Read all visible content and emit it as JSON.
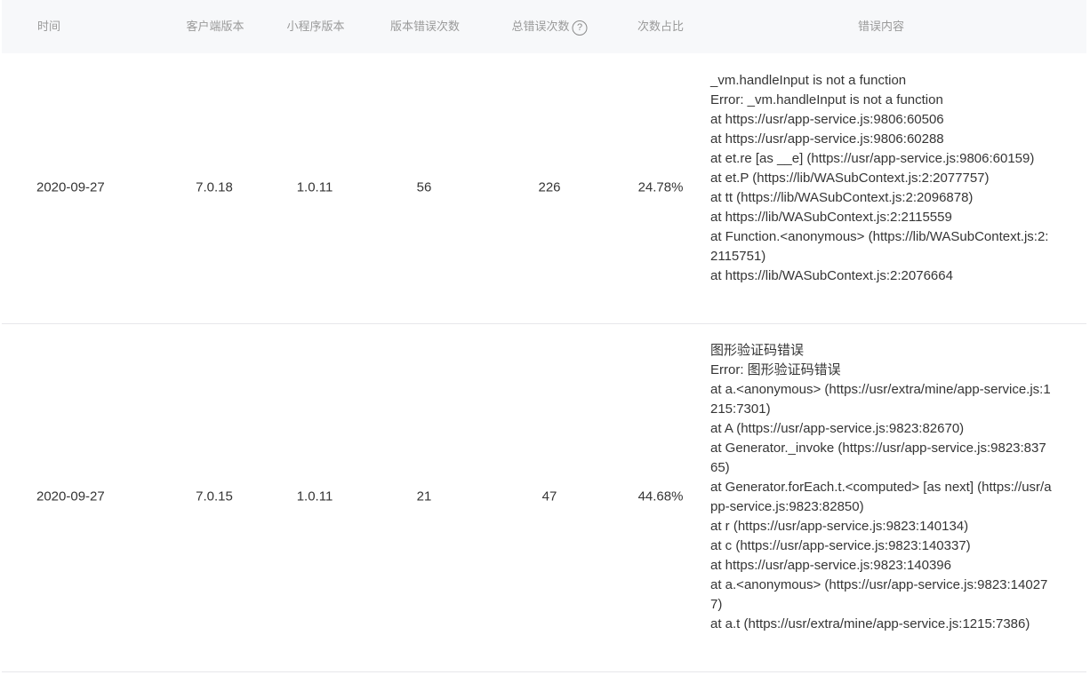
{
  "headers": {
    "time": "时间",
    "client_version": "客户端版本",
    "miniapp_version": "小程序版本",
    "version_error_count": "版本错误次数",
    "total_error_count": "总错误次数",
    "help_icon": "?",
    "ratio": "次数占比",
    "error_content": "错误内容"
  },
  "rows": [
    {
      "time": "2020-09-27",
      "client_version": "7.0.18",
      "miniapp_version": "1.0.11",
      "version_error_count": "56",
      "total_error_count": "226",
      "ratio": "24.78%",
      "error_lines": [
        "_vm.handleInput is not a function",
        "Error: _vm.handleInput is not a function",
        "at https://usr/app-service.js:9806:60506",
        "at https://usr/app-service.js:9806:60288",
        "at et.re [as __e] (https://usr/app-service.js:9806:60159)",
        "at et.P (https://lib/WASubContext.js:2:2077757)",
        "at tt (https://lib/WASubContext.js:2:2096878)",
        "at https://lib/WASubContext.js:2:2115559",
        "at Function.<anonymous> (https://lib/WASubContext.js:2:2115751)",
        "at https://lib/WASubContext.js:2:2076664"
      ]
    },
    {
      "time": "2020-09-27",
      "client_version": "7.0.15",
      "miniapp_version": "1.0.11",
      "version_error_count": "21",
      "total_error_count": "47",
      "ratio": "44.68%",
      "error_lines": [
        "图形验证码错误",
        "Error: 图形验证码错误",
        "at a.<anonymous> (https://usr/extra/mine/app-service.js:1215:7301)",
        "at A (https://usr/app-service.js:9823:82670)",
        "at Generator._invoke (https://usr/app-service.js:9823:83765)",
        "at Generator.forEach.t.<computed> [as next] (https://usr/app-service.js:9823:82850)",
        "at r (https://usr/app-service.js:9823:140134)",
        "at c (https://usr/app-service.js:9823:140337)",
        "at https://usr/app-service.js:9823:140396",
        "at a.<anonymous> (https://usr/app-service.js:9823:140277)",
        "at a.t (https://usr/extra/mine/app-service.js:1215:7386)"
      ]
    }
  ]
}
